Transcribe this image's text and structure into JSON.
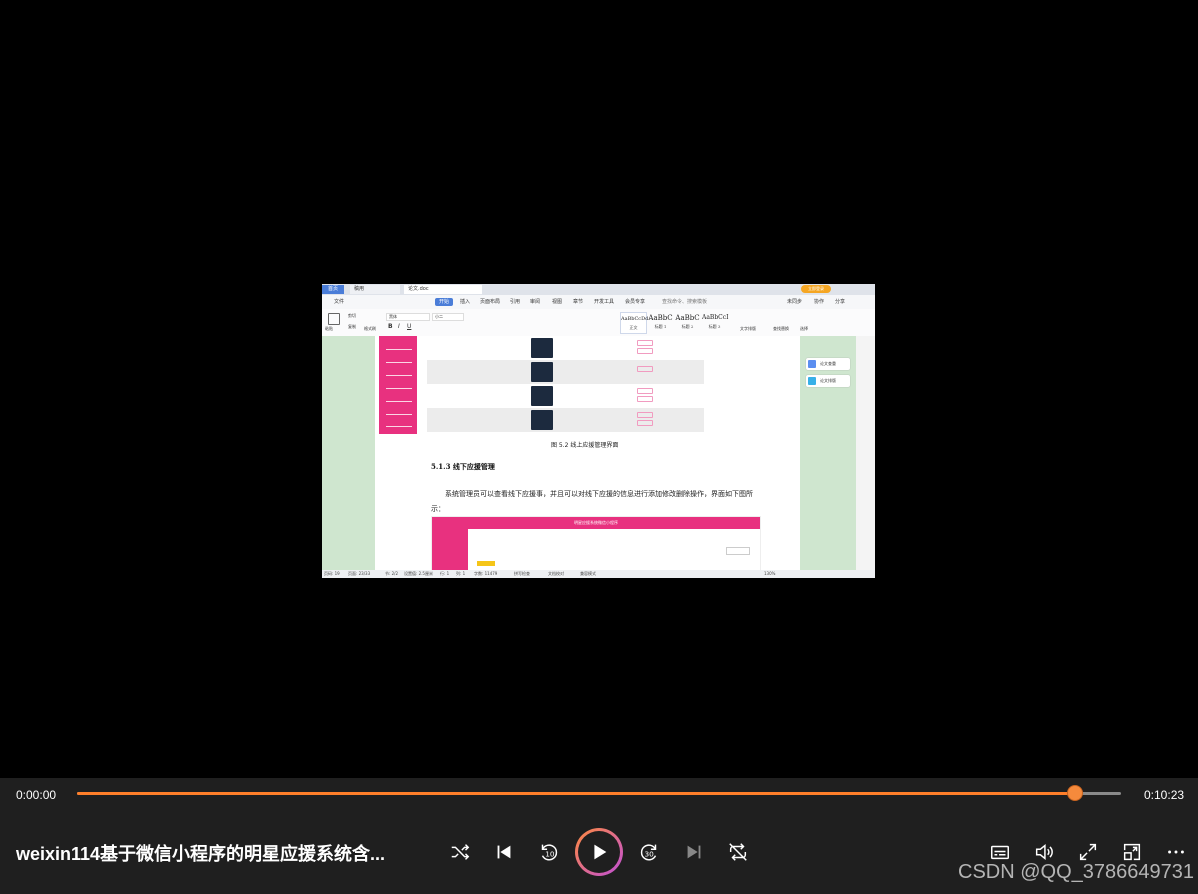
{
  "video": {
    "tabs": {
      "home": "首页",
      "draft": "稿用",
      "doc": "论文.doc"
    },
    "login_button": "立即登录",
    "menu": [
      "文件",
      "开始",
      "插入",
      "页面布局",
      "引用",
      "审阅",
      "视图",
      "章节",
      "开发工具",
      "会员专享"
    ],
    "menu_active": "开始",
    "menu_search": "查找命令、搜索模板",
    "menu_right": [
      "未同步",
      "协作",
      "分享"
    ],
    "ribbon": {
      "paste": "粘贴",
      "cut": "剪切",
      "copy": "复制",
      "format_painter": "格式刷",
      "font": "黑体",
      "font_size": "小二",
      "styles": [
        {
          "sample": "AaBbCcDd",
          "name": "正文"
        },
        {
          "sample": "AaBbC",
          "name": "标题 1"
        },
        {
          "sample": "AaBbC",
          "name": "标题 2"
        },
        {
          "sample": "AaBbCcI",
          "name": "标题 3"
        }
      ],
      "text_layout": "文字排版",
      "find_replace": "查找替换",
      "select": "选择"
    },
    "figure_caption": "图 5.2  线上应援管理界面",
    "section_heading": "5.1.3  线下应援管理",
    "body_text": "系统管理员可以查看线下应援事，并且可以对线下应援的信息进行添加修改删除操作，界面如下图所示：",
    "screenshot_header": "明星应援系统微信小程序",
    "right_panel": [
      "论文查重",
      "论文排版"
    ],
    "status": {
      "page": "页码: 19",
      "pages": "页面: 23/33",
      "section": "节: 2/2",
      "setting": "设置值: 2.5厘米",
      "row": "行: 1",
      "col": "列: 1",
      "words": "字数: 11479",
      "spell": "拼写检查",
      "proof": "文档校对",
      "mode": "兼容模式",
      "zoom": "130%"
    }
  },
  "player": {
    "current_time": "0:00:00",
    "duration": "0:10:23",
    "progress": 0.956,
    "title": "weixin114基于微信小程序的明星应援系统含...",
    "accent_color": "#ff7f2a",
    "controls_left": [
      "shuffle-icon",
      "previous-icon",
      "rewind-10-icon",
      "play-icon",
      "forward-30-icon",
      "next-icon",
      "repeat-off-icon"
    ],
    "controls_right": [
      "subtitles-icon",
      "volume-icon",
      "fullscreen-icon",
      "miniplayer-icon",
      "more-icon"
    ]
  },
  "watermark": "CSDN @QQ_3786649731"
}
